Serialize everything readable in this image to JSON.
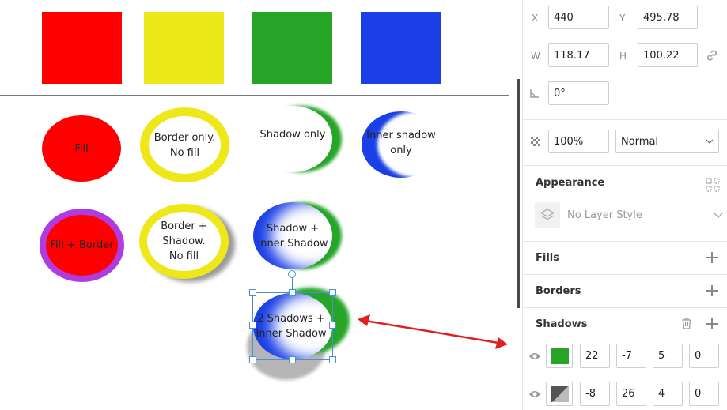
{
  "canvas": {
    "swatches": [
      {
        "color": "#ff0000"
      },
      {
        "color": "#eee81a"
      },
      {
        "color": "#26a529"
      },
      {
        "color": "#1a3fe6"
      }
    ],
    "shapes": {
      "fill": {
        "label": "Fill"
      },
      "border_only": {
        "label_line1": "Border only.",
        "label_line2": "No fill"
      },
      "shadow_only": {
        "label": "Shadow only"
      },
      "inner_shadow_only": {
        "label_line1": "Inner shadow",
        "label_line2": "only"
      },
      "fill_border": {
        "label": "Fill + Border"
      },
      "border_shadow": {
        "label_line1": "Border +",
        "label_line2": "Shadow.",
        "label_line3": "No fill"
      },
      "shadow_inner": {
        "label_line1": "Shadow +",
        "label_line2": "Inner Shadow"
      },
      "two_shadows": {
        "label_line1": "2 Shadows +",
        "label_line2": "Inner Shadow"
      }
    },
    "colors": {
      "red": "#ff0000",
      "yellow": "#eee81a",
      "green": "#26a529",
      "blue": "#1a3fe6",
      "purple": "#b03ce0",
      "selection": "#4a8fd8",
      "arrow": "#e02020"
    }
  },
  "inspector": {
    "position": {
      "x_label": "X",
      "x_value": "440",
      "y_label": "Y",
      "y_value": "495.78"
    },
    "size": {
      "w_label": "W",
      "w_value": "118.17",
      "h_label": "H",
      "h_value": "100.22",
      "lock_icon": "link-icon"
    },
    "rotation": {
      "icon": "angle-icon",
      "value": "0°"
    },
    "opacity": {
      "icon": "opacity-icon",
      "value": "100%",
      "blend_mode": "Normal"
    },
    "appearance": {
      "title": "Appearance",
      "layer_style_placeholder": "No Layer Style"
    },
    "fills": {
      "title": "Fills"
    },
    "borders": {
      "title": "Borders"
    },
    "shadows": {
      "title": "Shadows",
      "items": [
        {
          "color": "#26a529",
          "x": "22",
          "y": "-7",
          "blur": "5",
          "spread": "0"
        },
        {
          "color": "#555555",
          "x": "-8",
          "y": "26",
          "blur": "4",
          "spread": "0"
        }
      ]
    }
  }
}
